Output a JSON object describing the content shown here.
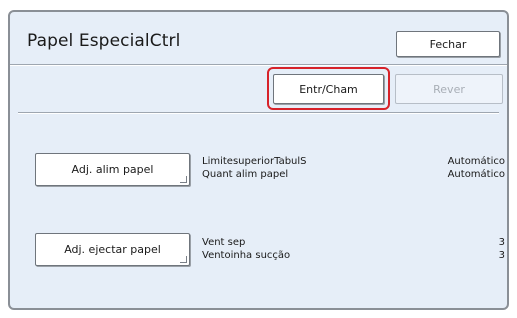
{
  "dialog": {
    "title": "Papel EspecialCtrl",
    "close_label": "Fechar"
  },
  "toolbar": {
    "entry_label": "Entr/Cham",
    "review_label": "Rever"
  },
  "settings": [
    {
      "button_label": "Adj. alim papel",
      "rows": [
        {
          "label": "LimitesuperiorTabulS",
          "value": "Automático"
        },
        {
          "label": "Quant alim papel",
          "value": "Automático"
        }
      ]
    },
    {
      "button_label": "Adj. ejectar papel",
      "rows": [
        {
          "label": "Vent sep",
          "value": "3"
        },
        {
          "label": "Ventoinha sucção",
          "value": "3"
        }
      ]
    }
  ],
  "colors": {
    "panel_background": "#e6eef8",
    "highlight": "#d7222a"
  }
}
